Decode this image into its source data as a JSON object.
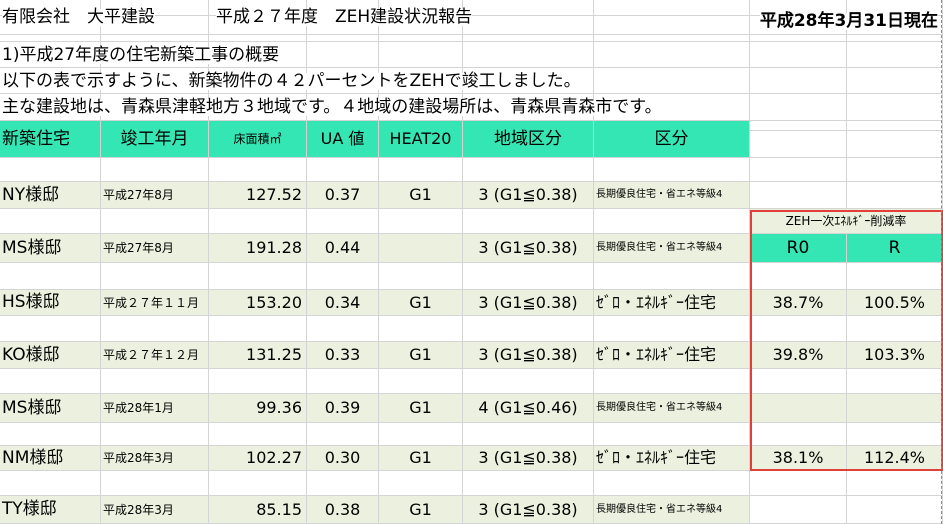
{
  "header": {
    "company": "有限会社　大平建設",
    "report_title": "平成２７年度　ZEH建設状況報告",
    "as_of": "平成28年3月31日現在"
  },
  "intro": {
    "section": "1)平成27年度の住宅新築工事の概要",
    "line1": "以下の表で示すように、新築物件の４２パーセントをZEHで竣工しました。",
    "line2": "主な建設地は、青森県津軽地方３地域です。４地域の建設場所は、青森県青森市です。"
  },
  "table": {
    "columns": [
      "新築住宅",
      "竣工年月",
      "床面積㎡",
      "UA 値",
      "HEAT20",
      "地域区分",
      "区分"
    ],
    "rows": [
      {
        "name": "NY様邸",
        "date": "平成27年8月",
        "area": "127.52",
        "ua": "0.37",
        "heat20": "G1",
        "region": "3 (G1≦0.38)",
        "category": "長期優良住宅・省エネ等級4"
      },
      {
        "name": "MS様邸",
        "date": "平成27年8月",
        "area": "191.28",
        "ua": "0.44",
        "heat20": "",
        "region": "3 (G1≦0.38)",
        "category": "長期優良住宅・省エネ等級4"
      },
      {
        "name": "HS様邸",
        "date": "平成２７年１１月",
        "area": "153.20",
        "ua": "0.34",
        "heat20": "G1",
        "region": "3 (G1≦0.38)",
        "category": "ｾﾞﾛ・ｴﾈﾙｷﾞｰ住宅"
      },
      {
        "name": "KO様邸",
        "date": "平成２７年１２月",
        "area": "131.25",
        "ua": "0.33",
        "heat20": "G1",
        "region": "3 (G1≦0.38)",
        "category": "ｾﾞﾛ・ｴﾈﾙｷﾞｰ住宅"
      },
      {
        "name": "MS様邸",
        "date": "平成28年1月",
        "area": "99.36",
        "ua": "0.39",
        "heat20": "G1",
        "region": "4 (G1≦0.46)",
        "category": "長期優良住宅・省エネ等級4"
      },
      {
        "name": "NM様邸",
        "date": "平成28年3月",
        "area": "102.27",
        "ua": "0.30",
        "heat20": "G1",
        "region": "3 (G1≦0.38)",
        "category": "ｾﾞﾛ・ｴﾈﾙｷﾞｰ住宅"
      },
      {
        "name": "TY様邸",
        "date": "平成28年3月",
        "area": "85.15",
        "ua": "0.38",
        "heat20": "G1",
        "region": "3 (G1≦0.38)",
        "category": "長期優良住宅・省エネ等級4"
      }
    ]
  },
  "zeh": {
    "title": "ZEH一次ｴﾈﾙｷﾞｰ削減率",
    "col_r0": "R0",
    "col_r": "R",
    "values": [
      {
        "r0": "38.7%",
        "r": "100.5%"
      },
      {
        "r0": "39.8%",
        "r": "103.3%"
      },
      {
        "r0": "",
        "r": ""
      },
      {
        "r0": "38.1%",
        "r": "112.4%"
      }
    ]
  },
  "colors": {
    "header_fill": "#33e6b3",
    "row_fill": "#ebf1de",
    "zeh_border": "#e0403a"
  }
}
